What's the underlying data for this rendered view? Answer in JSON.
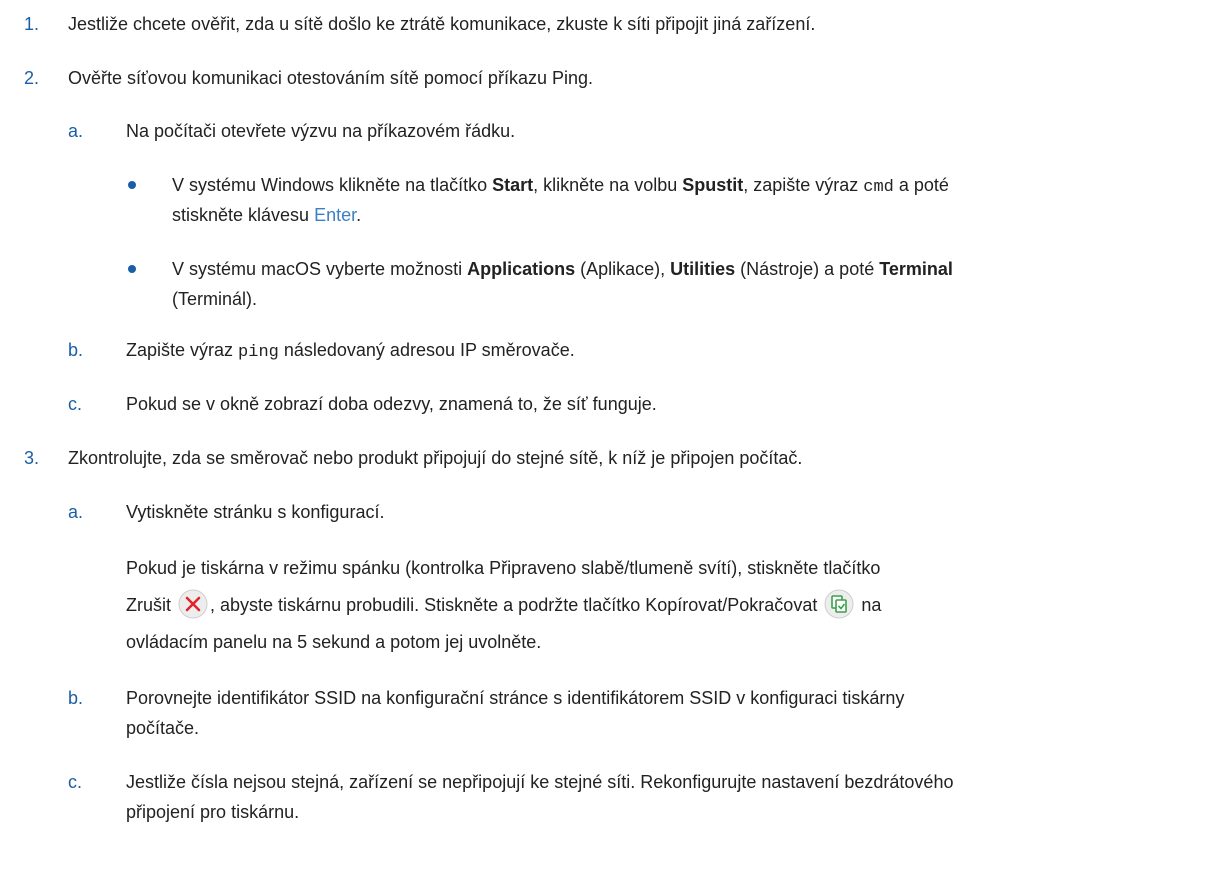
{
  "steps": [
    {
      "num": "1.",
      "text": "Jestliže chcete ověřit, zda u sítě došlo ke ztrátě komunikace, zkuste k síti připojit jiná zařízení."
    },
    {
      "num": "2.",
      "text": "Ověřte síťovou komunikaci otestováním sítě pomocí příkazu Ping."
    },
    {
      "num": "3.",
      "text": "Zkontrolujte, zda se směrovač nebo produkt připojují do stejné sítě, k níž je připojen počítač."
    }
  ],
  "step2": {
    "a": {
      "label": "a.",
      "text": "Na počítači otevřete výzvu na příkazovém řádku."
    },
    "bullet1": {
      "t1": "V systému Windows klikněte na tlačítko ",
      "b1": "Start",
      "t2": ", klikněte na volbu ",
      "b2": "Spustit",
      "t3": ", zapište výraz ",
      "code": "cmd",
      "t4": " a poté",
      "t5": "stiskněte klávesu ",
      "key": "Enter",
      "t6": "."
    },
    "bullet2": {
      "t1": "V systému macOS vyberte možnosti ",
      "b1": "Applications",
      "t2": " (Aplikace), ",
      "b2": "Utilities",
      "t3": " (Nástroje) a poté ",
      "b3": "Terminal",
      "t4": "(Terminál)."
    },
    "b": {
      "label": "b.",
      "t1": "Zapište výraz ",
      "code": "ping",
      "t2": " následovaný adresou IP směrovače."
    },
    "c": {
      "label": "c.",
      "text": "Pokud se v okně zobrazí doba odezvy, znamená to, že síť funguje."
    }
  },
  "step3": {
    "a": {
      "label": "a.",
      "text": "Vytiskněte stránku s konfigurací.",
      "para_line1": "Pokud je tiskárna v režimu spánku (kontrolka Připraveno slabě/tlumeně svítí), stiskněte tlačítko",
      "para_line2a": "Zrušit ",
      "para_line2b": ", abyste tiskárnu probudili. Stiskněte a podržte tlačítko Kopírovat/Pokračovat ",
      "para_line2c": " na",
      "para_line3": "ovládacím panelu na 5 sekund a potom jej uvolněte.",
      "cancel_icon": "cancel-x-icon",
      "copy_icon": "copy-resume-icon"
    },
    "b": {
      "label": "b.",
      "line1": "Porovnejte identifikátor SSID na konfigurační stránce s identifikátorem SSID v konfiguraci tiskárny",
      "line2": "počítače."
    },
    "c": {
      "label": "c.",
      "line1": "Jestliže čísla nejsou stejná, zařízení se nepřipojují ke stejné síti. Rekonfigurujte nastavení bezdrátového",
      "line2": "připojení pro tiskárnu."
    }
  },
  "colors": {
    "accent": "#1a5ea8",
    "key": "#3b7fc4",
    "cancel_red": "#e0262b"
  }
}
